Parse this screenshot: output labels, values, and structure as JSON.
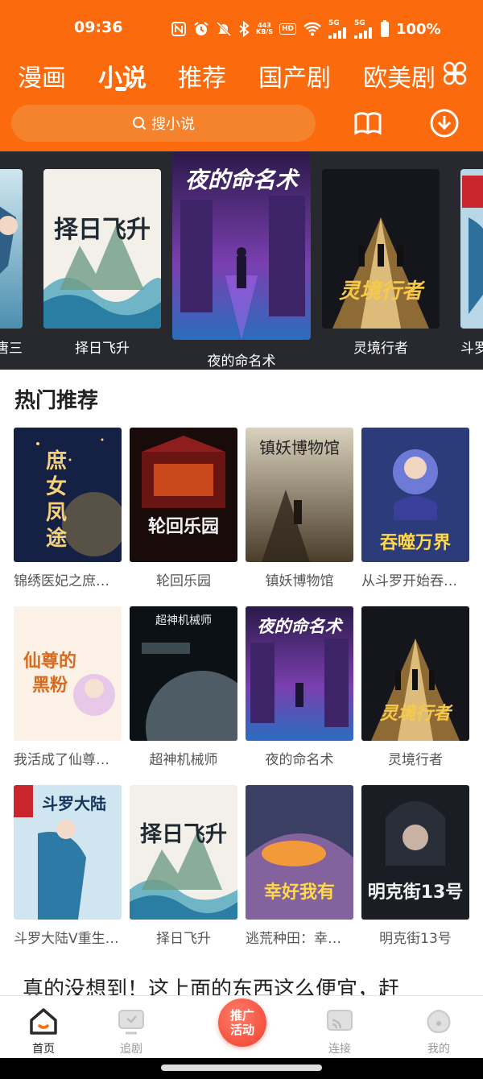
{
  "status_bar": {
    "time": "09:36",
    "net_speed_value": "443",
    "net_speed_unit": "KB/S",
    "hd_badge": "HD",
    "sim1": "5G",
    "sim2": "5G",
    "battery": "100%"
  },
  "tabs": [
    {
      "label": "漫画",
      "active": false
    },
    {
      "label": "小说",
      "active": true
    },
    {
      "label": "推荐",
      "active": false
    },
    {
      "label": "国产剧",
      "active": false
    },
    {
      "label": "欧美剧",
      "active": false
    }
  ],
  "search": {
    "placeholder": "搜小说",
    "icon": "search-icon"
  },
  "header_icons": {
    "grid": "grid-menu-icon",
    "bookshelf": "book-icon",
    "download": "download-icon"
  },
  "carousel": [
    {
      "title": "斗罗大陆V重生唐三",
      "visible_title": "唐三"
    },
    {
      "title": "择日飞升"
    },
    {
      "title": "夜的命名术"
    },
    {
      "title": "灵境行者"
    },
    {
      "title": "斗罗大陆"
    }
  ],
  "hot_section": {
    "title": "热门推荐",
    "books": [
      {
        "title": "锦绣医妃之庶女凤途",
        "cover_text": "庶女凤途"
      },
      {
        "title": "轮回乐园",
        "cover_text": "轮回乐园"
      },
      {
        "title": "镇妖博物馆",
        "cover_text": "镇妖博物馆"
      },
      {
        "title": "从斗罗开始吞噬万界",
        "cover_text": "吞噬万界"
      },
      {
        "title": "我活成了仙尊的黑粉",
        "cover_text": "仙尊的黑粉"
      },
      {
        "title": "超神机械师",
        "cover_text": "超神机械师"
      },
      {
        "title": "夜的命名术",
        "cover_text": "夜的命名术"
      },
      {
        "title": "灵境行者",
        "cover_text": "灵境行者"
      },
      {
        "title": "斗罗大陆V重生唐三",
        "cover_text": "斗罗大陆"
      },
      {
        "title": "择日飞升",
        "cover_text": "择日飞升"
      },
      {
        "title": "逃荒种田：幸好我有随身超市",
        "cover_text": "幸好我有"
      },
      {
        "title": "明克街13号",
        "cover_text": "明克街13号"
      }
    ]
  },
  "promo_text": "真的没想到！这上面的东西这么便宜，赶",
  "bottom_nav": [
    {
      "label": "首页",
      "active": true,
      "icon": "home-icon"
    },
    {
      "label": "追剧",
      "active": false,
      "icon": "tv-icon"
    },
    {
      "label": "推广活动",
      "line1": "推广",
      "line2": "活动",
      "icon": "promo-button"
    },
    {
      "label": "连接",
      "active": false,
      "icon": "cast-icon"
    },
    {
      "label": "我的",
      "active": false,
      "icon": "profile-icon"
    }
  ],
  "colors": {
    "accent": "#fb6a0d",
    "carousel_bg": "#27292f",
    "promo_red": "#f0402c"
  }
}
